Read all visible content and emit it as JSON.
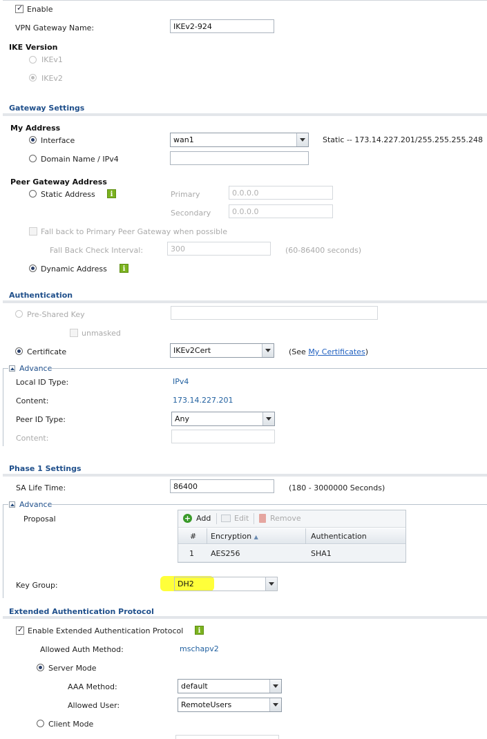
{
  "general": {
    "enable_label": "Enable",
    "gateway_name_label": "VPN Gateway Name:",
    "gateway_name_value": "IKEv2-924",
    "ike_version_title": "IKE Version",
    "ikev1_label": "IKEv1",
    "ikev2_label": "IKEv2"
  },
  "gateway_settings": {
    "title": "Gateway Settings",
    "my_address_title": "My Address",
    "interface_label": "Interface",
    "interface_value": "wan1",
    "interface_status": "Static -- 173.14.227.201/255.255.255.248",
    "domain_label": "Domain Name / IPv4",
    "domain_value": "",
    "peer_title": "Peer Gateway Address",
    "static_address_label": "Static Address",
    "primary_label": "Primary",
    "primary_value": "0.0.0.0",
    "secondary_label": "Secondary",
    "secondary_value": "0.0.0.0",
    "fallback_label": "Fall back to Primary Peer Gateway when possible",
    "fallback_interval_label": "Fall Back Check Interval:",
    "fallback_interval_value": "300",
    "fallback_interval_hint": "(60-86400 seconds)",
    "dynamic_address_label": "Dynamic Address"
  },
  "authentication": {
    "title": "Authentication",
    "psk_label": "Pre-Shared Key",
    "psk_value": "",
    "unmasked_label": "unmasked",
    "certificate_label": "Certificate",
    "certificate_value": "IKEv2Cert",
    "see_prefix": "(See ",
    "see_link": "My Certificates",
    "see_suffix": ")",
    "advance_label": "Advance",
    "local_id_type_label": "Local ID Type:",
    "local_id_type_value": "IPv4",
    "content_label": "Content:",
    "content_value": "173.14.227.201",
    "peer_id_type_label": "Peer ID Type:",
    "peer_id_type_value": "Any",
    "peer_content_label": "Content:",
    "peer_content_value": ""
  },
  "phase1": {
    "title": "Phase 1 Settings",
    "sa_life_label": "SA Life Time:",
    "sa_life_value": "86400",
    "sa_life_hint": "(180 - 3000000 Seconds)",
    "advance_label": "Advance",
    "proposal_label": "Proposal",
    "add_label": "Add",
    "edit_label": "Edit",
    "remove_label": "Remove",
    "columns": [
      "#",
      "Encryption",
      "Authentication"
    ],
    "sort_indicator": "▲",
    "rows": [
      {
        "num": "1",
        "encryption": "AES256",
        "authentication": "SHA1"
      }
    ],
    "key_group_label": "Key Group:",
    "key_group_value": "DH2",
    "highlight_color": "#ffff3a"
  },
  "xauth": {
    "title": "Extended Authentication Protocol",
    "enable_label": "Enable Extended Authentication Protocol",
    "allowed_method_label": "Allowed Auth Method:",
    "allowed_method_value": "mschapv2",
    "server_mode_label": "Server Mode",
    "aaa_method_label": "AAA Method:",
    "aaa_method_value": "default",
    "allowed_user_label": "Allowed User:",
    "allowed_user_value": "RemoteUsers",
    "client_mode_label": "Client Mode"
  },
  "icons": {
    "info": "info-icon",
    "add": "add-icon",
    "edit": "edit-icon",
    "remove": "trash-icon"
  }
}
